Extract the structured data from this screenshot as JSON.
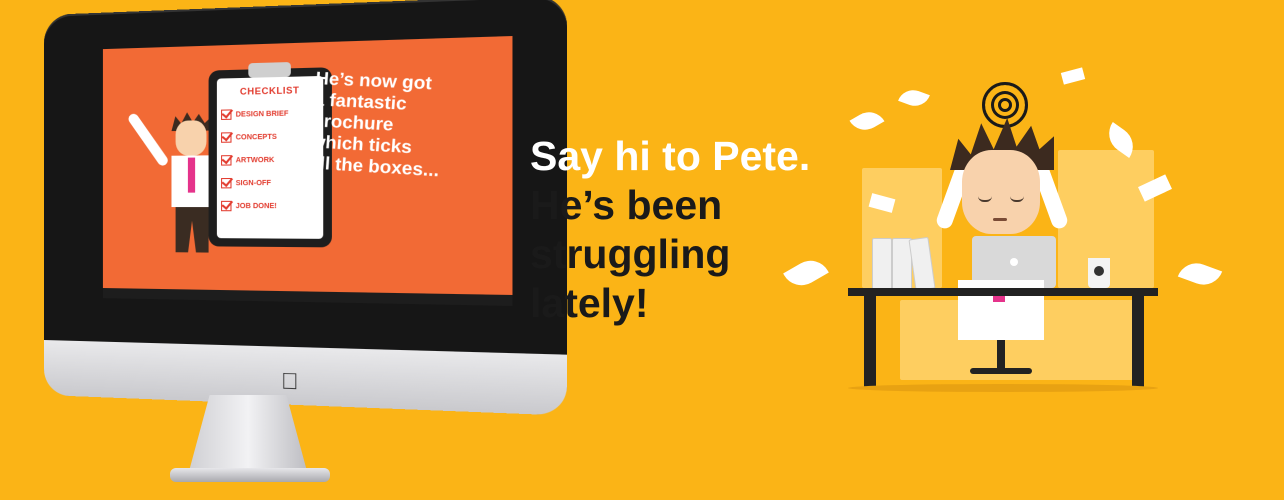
{
  "headline": {
    "line1": "Say hi to Pete.",
    "line2": "He’s been",
    "line3": "struggling",
    "line4": "lately!"
  },
  "screen": {
    "checklist_title": "CHECKLIST",
    "checklist_items": [
      "DESIGN BRIEF",
      "CONCEPTS",
      "ARTWORK",
      "SIGN-OFF",
      "JOB DONE!"
    ],
    "message_lines": [
      "He’s now got",
      "a fantastic",
      "brochure",
      "which ticks",
      "all the boxes..."
    ]
  },
  "icons": {
    "apple": "apple-logo-icon"
  },
  "colors": {
    "background": "#fbb416",
    "screen_orange": "#f26a35",
    "checklist_red": "#e23b2e",
    "tie_pink": "#e5338b"
  }
}
